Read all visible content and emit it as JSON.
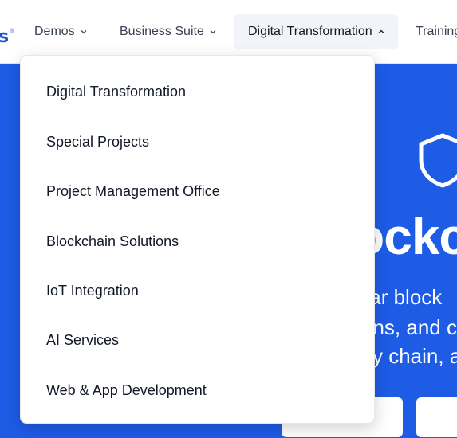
{
  "nav": {
    "logo_fragment": "s",
    "logo_mark": "®",
    "items": [
      {
        "label": "Demos",
        "icon": "chevron-down-icon"
      },
      {
        "label": "Business Suite",
        "icon": "chevron-down-icon"
      },
      {
        "label": "Digital Transformation",
        "icon": "chevron-up-icon",
        "active": true
      },
      {
        "label": "Training"
      }
    ]
  },
  "dropdown": {
    "items": [
      {
        "label": "Digital Transformation"
      },
      {
        "label": "Special Projects"
      },
      {
        "label": "Project Management Office"
      },
      {
        "label": "Blockchain Solutions"
      },
      {
        "label": "IoT Integration"
      },
      {
        "label": "AI Services"
      },
      {
        "label": "Web & App Development"
      }
    ]
  },
  "hero": {
    "icon": "shield-icon",
    "title_fragment": "ockc",
    "line1": "ular block",
    "line2": "ons, and c",
    "line3": "y chain, a"
  },
  "colors": {
    "hero_bg": "#1e5ce6",
    "nav_active_bg": "#f1f5f9",
    "logo": "#1d4ed8"
  }
}
